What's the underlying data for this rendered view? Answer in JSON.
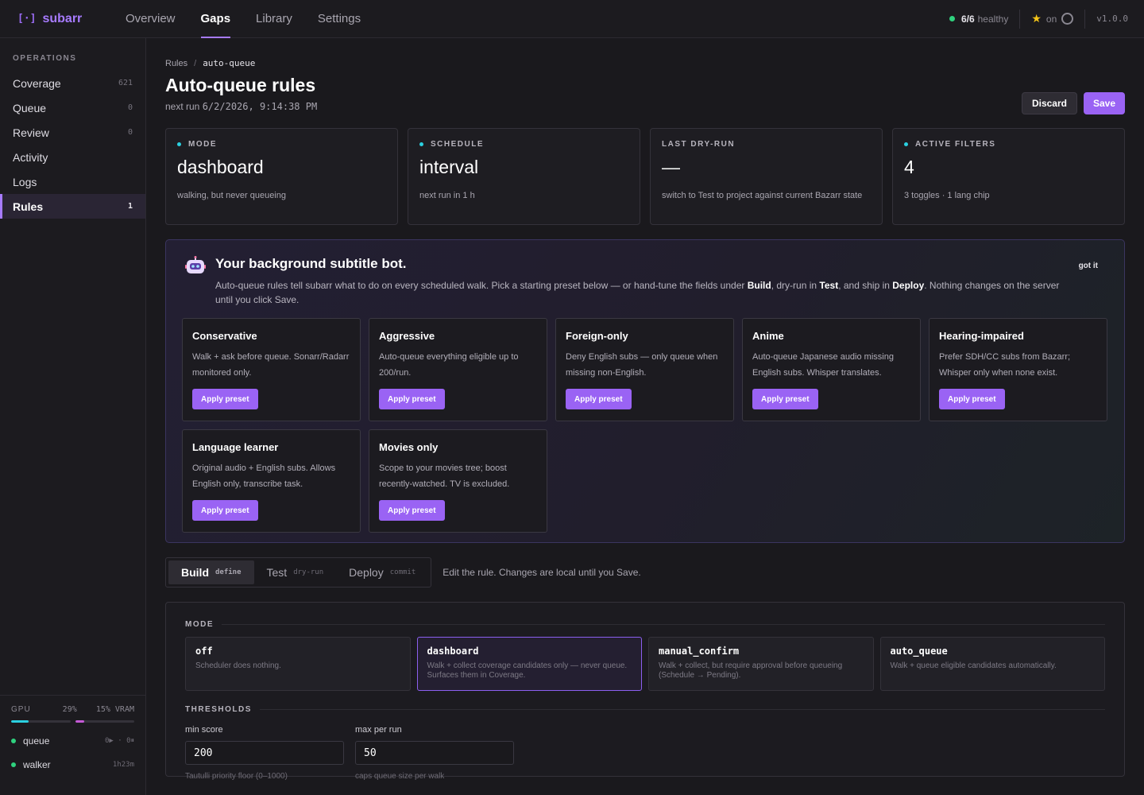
{
  "app": {
    "logo_mark": "[·]",
    "name": "subarr",
    "version": "v1.0.0"
  },
  "nav": [
    {
      "label": "Overview",
      "active": false
    },
    {
      "label": "Gaps",
      "active": true
    },
    {
      "label": "Library",
      "active": false
    },
    {
      "label": "Settings",
      "active": false
    }
  ],
  "status": {
    "healthy_count": "6/6",
    "healthy_label": "healthy",
    "star_label": "on"
  },
  "sidebar": {
    "heading": "OPERATIONS",
    "items": [
      {
        "label": "Coverage",
        "count": "621"
      },
      {
        "label": "Queue",
        "count": "0"
      },
      {
        "label": "Review",
        "count": "0"
      },
      {
        "label": "Activity",
        "count": ""
      },
      {
        "label": "Logs",
        "count": ""
      },
      {
        "label": "Rules",
        "count": "1"
      }
    ],
    "gpu": {
      "label": "GPU",
      "usage": "29%",
      "vram": "15% VRAM",
      "usage_fraction": 0.29,
      "vram_fraction": 0.15
    },
    "workers": [
      {
        "name": "queue",
        "meta": "0▶ · 0⏸"
      },
      {
        "name": "walker",
        "meta": "1h23m"
      }
    ]
  },
  "page": {
    "breadcrumb_root": "Rules",
    "breadcrumb_sep": "/",
    "breadcrumb_current": "auto-queue",
    "title": "Auto-queue rules",
    "subline_prefix": "next run",
    "subline_value": "6/2/2026, 9:14:38 PM",
    "discard_label": "Discard",
    "save_label": "Save"
  },
  "stats": [
    {
      "label": "MODE",
      "value": "dashboard",
      "desc": "walking, but never queueing",
      "dot": true
    },
    {
      "label": "SCHEDULE",
      "value": "interval",
      "desc": "next run in 1 h",
      "dot": true
    },
    {
      "label": "LAST DRY-RUN",
      "value": "—",
      "desc": "switch to Test to project against current Bazarr state",
      "dot": false
    },
    {
      "label": "ACTIVE FILTERS",
      "value": "4",
      "desc": "3 toggles · 1 lang chip",
      "dot": true
    }
  ],
  "bot": {
    "title": "Your background subtitle bot.",
    "desc_1": "Auto-queue rules tell subarr what to do on every scheduled walk. Pick a starting preset below — or hand-tune the fields under ",
    "desc_build": "Build",
    "desc_2": ", dry-run in ",
    "desc_test": "Test",
    "desc_3": ", and ship in ",
    "desc_deploy": "Deploy",
    "desc_4": ". Nothing changes on the server until you click Save.",
    "dismiss_label": "got it",
    "apply_label": "Apply preset",
    "presets": [
      {
        "name": "Conservative",
        "desc": "Walk + ask before queue. Sonarr/Radarr monitored only."
      },
      {
        "name": "Aggressive",
        "desc": "Auto-queue everything eligible up to 200/run."
      },
      {
        "name": "Foreign-only",
        "desc": "Deny English subs — only queue when missing non-English."
      },
      {
        "name": "Anime",
        "desc": "Auto-queue Japanese audio missing English subs. Whisper translates."
      },
      {
        "name": "Hearing-impaired",
        "desc": "Prefer SDH/CC subs from Bazarr; Whisper only when none exist."
      },
      {
        "name": "Language learner",
        "desc": "Original audio + English subs. Allows English only, transcribe task."
      },
      {
        "name": "Movies only",
        "desc": "Scope to your movies tree; boost recently-watched. TV is excluded."
      }
    ]
  },
  "tabs": [
    {
      "label": "Build",
      "hint": "define",
      "active": true
    },
    {
      "label": "Test",
      "hint": "dry-run",
      "active": false
    },
    {
      "label": "Deploy",
      "hint": "commit",
      "active": false
    }
  ],
  "tabs_note": "Edit the rule. Changes are local until you Save.",
  "build": {
    "mode_label": "MODE",
    "modes": [
      {
        "name": "off",
        "desc": "Scheduler does nothing.",
        "active": false
      },
      {
        "name": "dashboard",
        "desc": "Walk + collect coverage candidates only — never queue. Surfaces them in Coverage.",
        "active": true
      },
      {
        "name": "manual_confirm",
        "desc": "Walk + collect, but require approval before queueing (Schedule → Pending).",
        "active": false
      },
      {
        "name": "auto_queue",
        "desc": "Walk + queue eligible candidates automatically.",
        "active": false
      }
    ],
    "thresholds_label": "THRESHOLDS",
    "fields": [
      {
        "label": "min score",
        "value": "200",
        "help": "Tautulli priority floor (0–1000)"
      },
      {
        "label": "max per run",
        "value": "50",
        "help": "caps queue size per walk"
      }
    ]
  },
  "colors": {
    "accent": "#9a63f4",
    "healthy": "#2fd17e",
    "info_dot": "#2bd0e0"
  }
}
